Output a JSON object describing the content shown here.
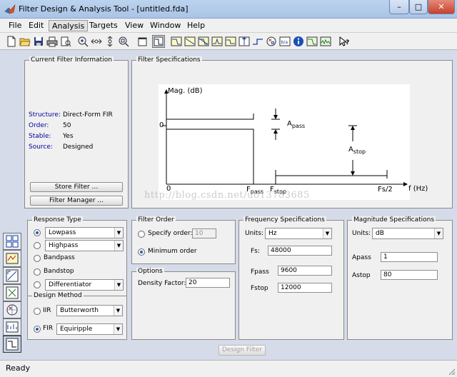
{
  "window": {
    "title": "Filter Design & Analysis Tool - [untitled.fda]"
  },
  "menu": [
    "File",
    "Edit",
    "Analysis",
    "Targets",
    "View",
    "Window",
    "Help"
  ],
  "current_filter": {
    "title": "Current Filter Information",
    "structure_label": "Structure:",
    "structure_value": "Direct-Form FIR",
    "order_label": "Order:",
    "order_value": "50",
    "stable_label": "Stable:",
    "stable_value": "Yes",
    "source_label": "Source:",
    "source_value": "Designed",
    "store_button": "Store Filter ...",
    "manager_button": "Filter Manager ..."
  },
  "filter_specs": {
    "title": "Filter Specifications",
    "mag_label": "Mag. (dB)",
    "zero_label": "0",
    "x_zero": "0",
    "fpass": "F",
    "fpass_sub": "pass",
    "fstop": "F",
    "fstop_sub": "stop",
    "apass": "A",
    "apass_sub": "pass",
    "astop": "A",
    "astop_sub": "stop",
    "fs2": "Fs/2",
    "freq_label": "f (Hz)"
  },
  "watermark": "http://blog.csdn.net/u013783685",
  "response_type": {
    "title": "Response Type",
    "lowpass": "Lowpass",
    "highpass": "Highpass",
    "bandpass": "Bandpass",
    "bandstop": "Bandstop",
    "differentiator": "Differentiator"
  },
  "design_method": {
    "title": "Design Method",
    "iir_label": "IIR",
    "iir_value": "Butterworth",
    "fir_label": "FIR",
    "fir_value": "Equiripple"
  },
  "filter_order": {
    "title": "Filter Order",
    "specify_label": "Specify order:",
    "specify_value": "10",
    "minimum_label": "Minimum order"
  },
  "options": {
    "title": "Options",
    "density_label": "Density Factor:",
    "density_value": "20"
  },
  "freq_specs": {
    "title": "Frequency Specifications",
    "units_label": "Units:",
    "units_value": "Hz",
    "fs_label": "Fs:",
    "fs_value": "48000",
    "fpass_label": "Fpass",
    "fpass_value": "9600",
    "fstop_label": "Fstop",
    "fstop_value": "12000"
  },
  "mag_specs": {
    "title": "Magnitude Specifications",
    "units_label": "Units:",
    "units_value": "dB",
    "apass_label": "Apass",
    "apass_value": "1",
    "astop_label": "Astop",
    "astop_value": "80"
  },
  "design_button": "Design Filter",
  "status": "Ready"
}
